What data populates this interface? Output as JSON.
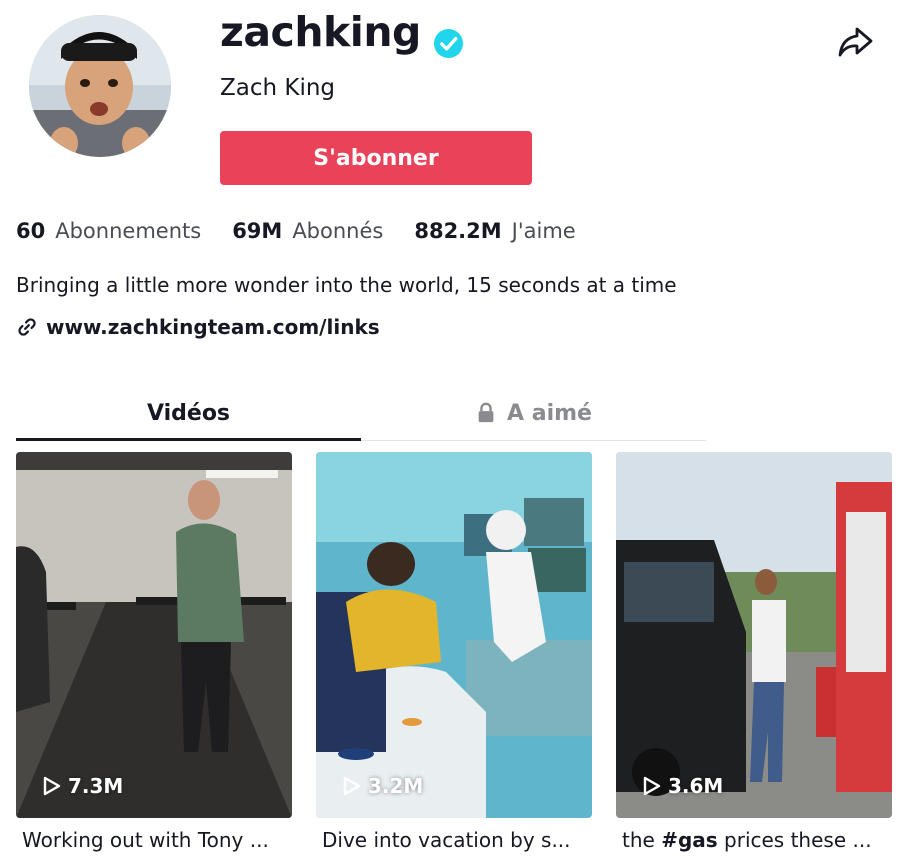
{
  "profile": {
    "username": "zachking",
    "nickname": "Zach King",
    "verified": true,
    "follow_label": "S'abonner",
    "bio": "Bringing a little more wonder into the world, 15 seconds at a time",
    "link": "www.zachkingteam.com/links"
  },
  "stats": [
    {
      "value": "60",
      "label": "Abonnements"
    },
    {
      "value": "69M",
      "label": "Abonnés"
    },
    {
      "value": "882.2M",
      "label": "J'aime"
    }
  ],
  "tabs": {
    "videos": "Vidéos",
    "liked": "A aimé"
  },
  "videos": [
    {
      "plays": "7.3M",
      "caption": "Working out with Tony ..."
    },
    {
      "plays": "3.2M",
      "caption": "Dive into vacation by s..."
    },
    {
      "plays": "3.6M",
      "caption_pre": "the ",
      "caption_tag": "#gas",
      "caption_post": " prices these ..."
    }
  ],
  "colors": {
    "follow": "#ea4359",
    "verified": "#20d5ec",
    "text": "#161823",
    "muted": "#8a8b91"
  },
  "icons": {
    "verified": "verified-badge-icon",
    "share": "share-arrow-icon",
    "link": "link-icon",
    "lock": "lock-icon",
    "play": "play-icon"
  }
}
